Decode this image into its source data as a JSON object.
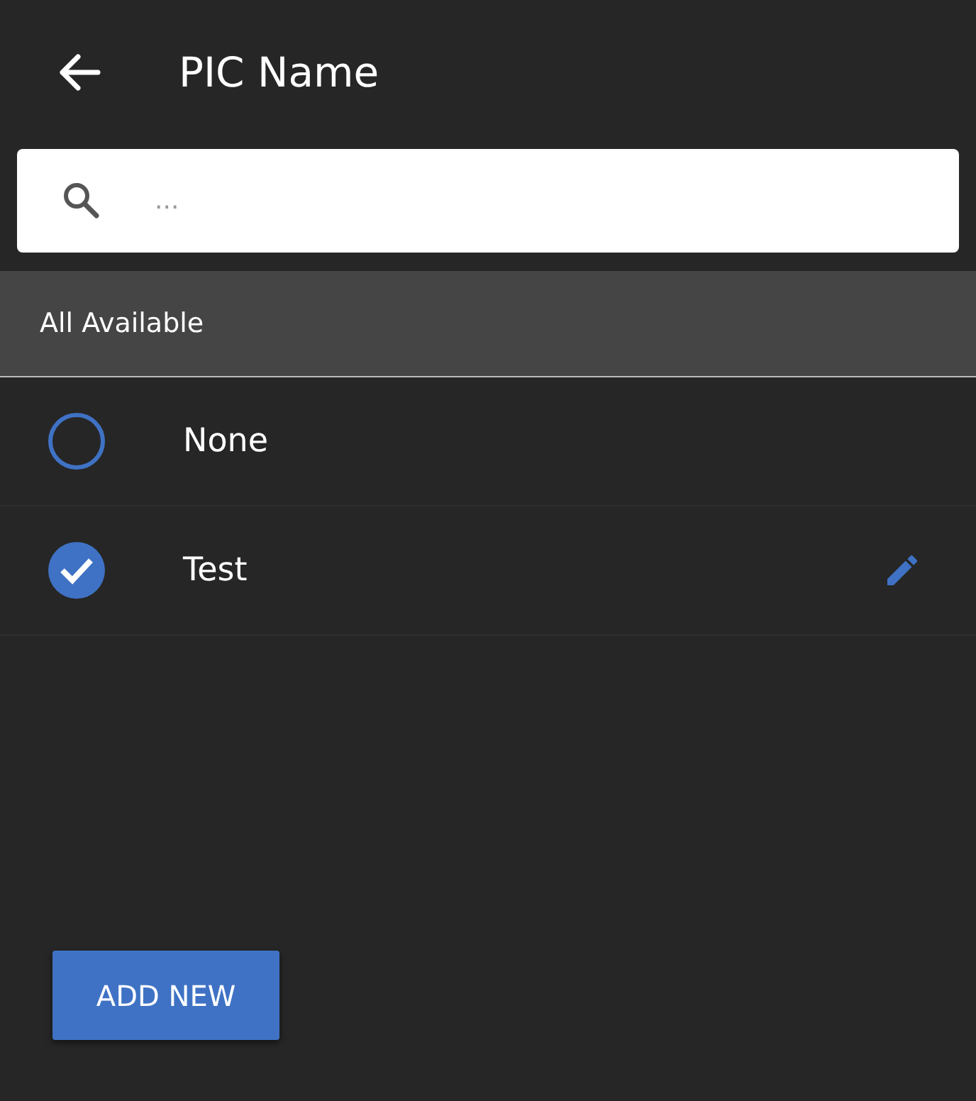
{
  "header": {
    "title": "PIC Name"
  },
  "search": {
    "placeholder": "..."
  },
  "section": {
    "label": "All Available"
  },
  "options": [
    {
      "label": "None",
      "selected": false,
      "editable": false
    },
    {
      "label": "Test",
      "selected": true,
      "editable": true
    }
  ],
  "add_button": {
    "label": "ADD NEW"
  }
}
